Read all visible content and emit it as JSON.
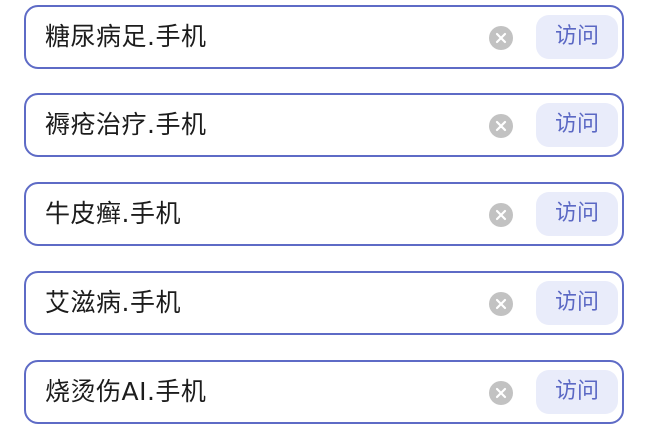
{
  "colors": {
    "border": "#5e6bc6",
    "accent": "#5b68c4",
    "button_bg": "#e9ecfa",
    "clear_icon_bg": "#c2c2c2"
  },
  "domains": [
    {
      "value": "糖尿病足.手机",
      "clear_icon": "clear-icon",
      "visit_label": "访问"
    },
    {
      "value": "褥疮治疗.手机",
      "clear_icon": "clear-icon",
      "visit_label": "访问"
    },
    {
      "value": "牛皮癣.手机",
      "clear_icon": "clear-icon",
      "visit_label": "访问"
    },
    {
      "value": "艾滋病.手机",
      "clear_icon": "clear-icon",
      "visit_label": "访问"
    },
    {
      "value": "烧烫伤AI.手机",
      "clear_icon": "clear-icon",
      "visit_label": "访问"
    }
  ]
}
